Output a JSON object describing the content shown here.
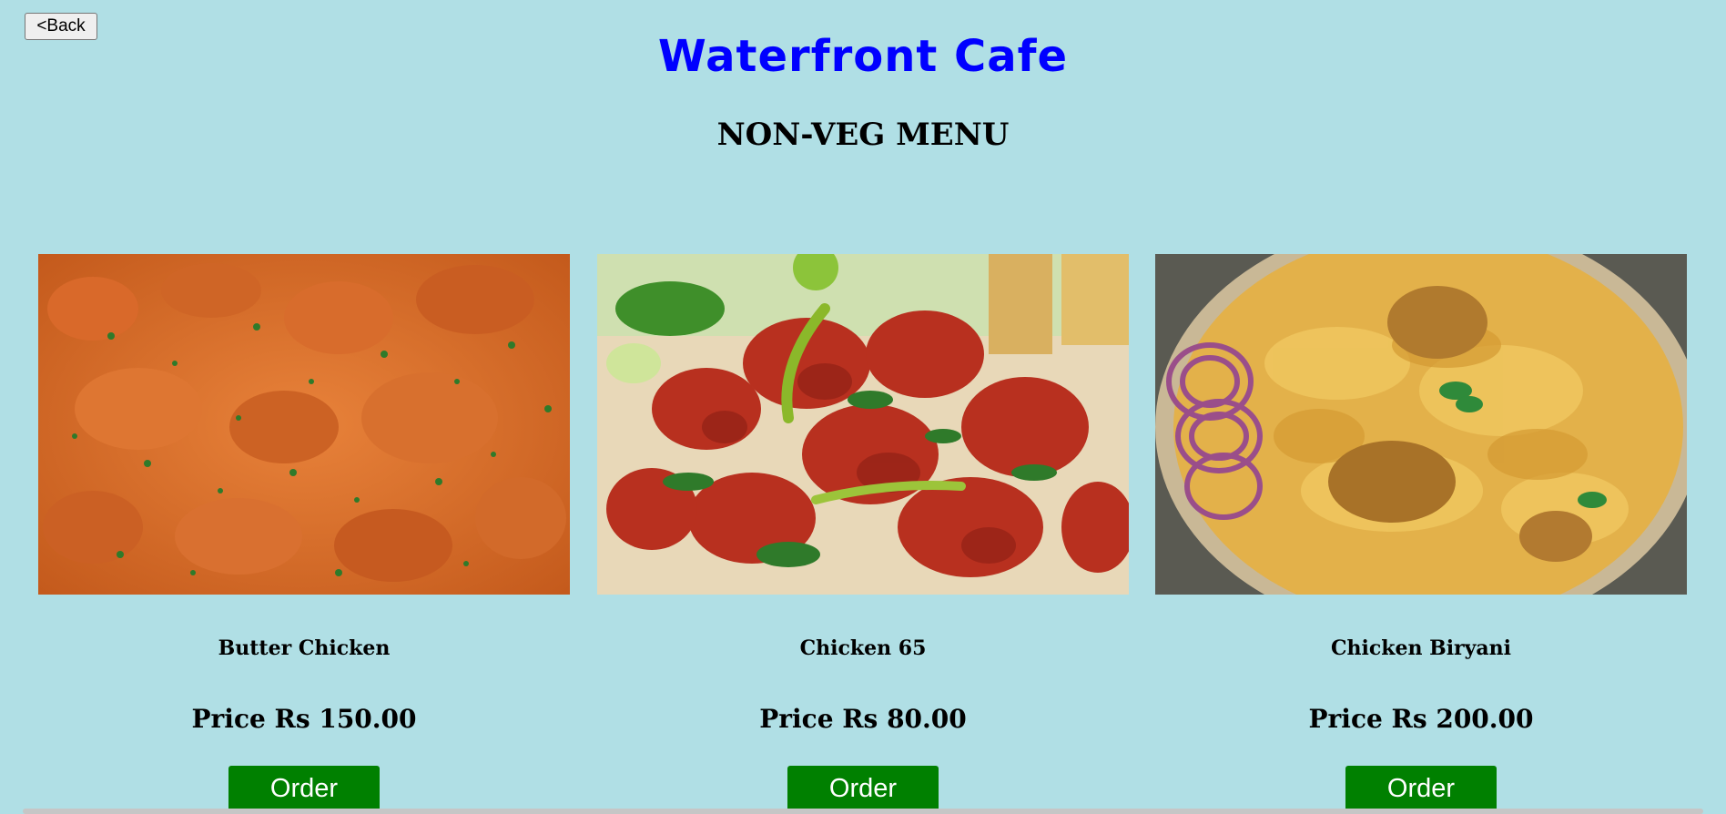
{
  "header": {
    "back_label": "<Back",
    "title": "Waterfront Cafe",
    "subtitle": "NON-VEG MENU"
  },
  "menu": {
    "items": [
      {
        "name": "Butter Chicken",
        "price": "Price Rs 150.00",
        "order_label": "Order",
        "image": "butter-chicken-photo"
      },
      {
        "name": "Chicken 65",
        "price": "Price Rs 80.00",
        "order_label": "Order",
        "image": "chicken-65-photo"
      },
      {
        "name": "Chicken Biryani",
        "price": "Price Rs 200.00",
        "order_label": "Order",
        "image": "chicken-biryani-photo"
      }
    ]
  },
  "colors": {
    "background": "#b0dfe5",
    "title": "#0000ff",
    "order_button": "#008000"
  }
}
